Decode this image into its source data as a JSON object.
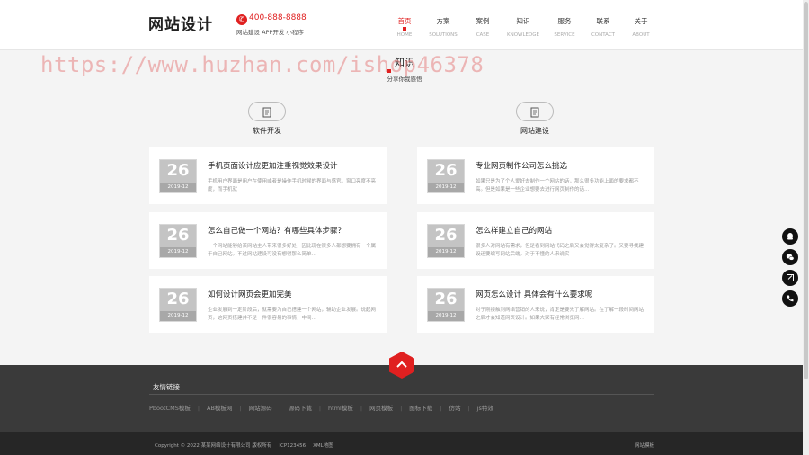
{
  "header": {
    "logo": "网站设计",
    "phone": "400-888-8888",
    "slogan": "网站建设 APP开发 小程序",
    "nav": [
      {
        "cn": "首页",
        "en": "HOME",
        "active": true
      },
      {
        "cn": "方案",
        "en": "SOLUTIONS"
      },
      {
        "cn": "案例",
        "en": "CASE"
      },
      {
        "cn": "知识",
        "en": "KNOWLEDGE"
      },
      {
        "cn": "服务",
        "en": "SERVICE"
      },
      {
        "cn": "联系",
        "en": "CONTACT"
      },
      {
        "cn": "关于",
        "en": "ABOUT"
      }
    ]
  },
  "watermark": "https://www.huzhan.com/ishop46378",
  "section": {
    "title": "知识",
    "subtitle": "分享你我感悟"
  },
  "columns": [
    {
      "name": "软件开发",
      "icon": "document-icon",
      "articles": [
        {
          "day": "26",
          "ym": "2019-12",
          "title": "手机页面设计应更加注重视觉效果设计",
          "desc": "手机用户界面是用户在使用或者是操作手机时候的界面与感官。窗口亮度不亮度，而手机就"
        },
        {
          "day": "26",
          "ym": "2019-12",
          "title": "怎么自己做一个网站？有哪些具体步骤？",
          "desc": "一个网站能够给该网站主人带来很多好处，因此现在很多人都想要拥有一个属于自己网站。不过网站建设可没有想得那么简单…"
        },
        {
          "day": "26",
          "ym": "2019-12",
          "title": "如何设计网页会更加完美",
          "desc": "企业发展到一定阶段后，就需要为自己搭建一个网站，辅助企业发展。说起网页，这网页搭建并不是一件很容易的事情，中间…"
        }
      ]
    },
    {
      "name": "网站建设",
      "icon": "document-icon",
      "articles": [
        {
          "day": "26",
          "ym": "2019-12",
          "title": "专业网页制作公司怎么挑选",
          "desc": "如果只是为了个人爱好去制作一个网站的话，那么很多功能上面的要求都不高。但是如果是一些企业想要去进行网页制作的话…"
        },
        {
          "day": "26",
          "ym": "2019-12",
          "title": "怎么样建立自己的网站",
          "desc": "很多人对网站有需求，但是看到网站代码之后又会觉得太复杂了。又要寻找建设还要编写网站后端。对于不懂的人来说实"
        },
        {
          "day": "26",
          "ym": "2019-12",
          "title": "网页怎么设计 具体会有什么要求呢",
          "desc": "对于刚接触到网络营销的人来说，肯定是要先了解网站。在了解一段时间网站之后才会知道网页设计。如果大家有经常浏览网…"
        }
      ]
    }
  ],
  "footer": {
    "links_title": "友情链接",
    "links": [
      "PbootCMS模板",
      "AB模板网",
      "网站源码",
      "源码下载",
      "html模板",
      "网页模板",
      "图标下载",
      "仿站",
      "js特效"
    ],
    "copyright": "Copyright © 2022 某某网络设计有限公司 版权所有",
    "icp": "ICP123456",
    "sitemap": "XML地图",
    "site_tpl": "网站模板"
  },
  "side_buttons": [
    "qq-icon",
    "wechat-icon",
    "message-icon",
    "phone-icon"
  ],
  "colors": {
    "accent": "#e02020",
    "footer_bg": "#3a3a3a",
    "bottom_bg": "#262626"
  }
}
